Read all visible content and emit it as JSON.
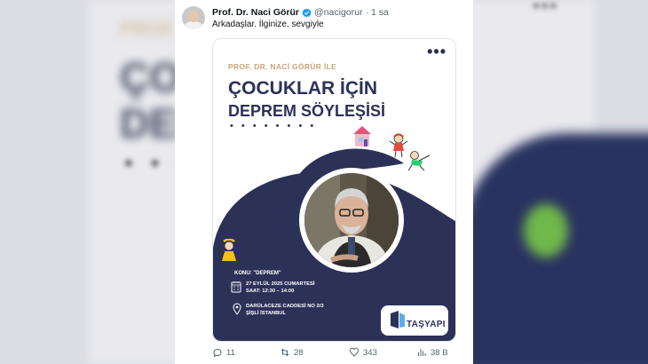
{
  "tweet": {
    "author_name": "Prof. Dr. Naci Görür",
    "author_handle": "@nacigorur",
    "separator": "·",
    "time": "1 sa",
    "text": "Arkadaşlar. İlginize, sevgiyle"
  },
  "poster": {
    "subtitle": "PROF. DR. NACİ GÖRÜR İLE",
    "title_line1": "ÇOCUKLAR İÇİN",
    "title_line2": "DEPREM SÖYLEŞİSİ",
    "dots": "• • • • • • • •",
    "konu": "KONU: \"DEPREM\"",
    "date": "27 EYLÜL 2025 CUMARTESİ",
    "saat": "SAAT: 12:30 – 14:00",
    "address_line1": "DARÜLACEZE CADDESİ NO 2/3",
    "address_line2": "ŞİŞLİ İSTANBUL",
    "brand": "TAŞYAPI",
    "menu_label": "•••"
  },
  "actions": {
    "replies": "11",
    "reposts": "28",
    "likes": "343",
    "views": "38 B"
  },
  "background": {
    "blur_small": "PROF. DR.",
    "blur_line1": "ÇOC",
    "blur_line2": "DEP",
    "blur_more": "•••"
  },
  "icons": {
    "verified": "verified-badge-icon",
    "reply": "reply-icon",
    "repost": "repost-icon",
    "like": "heart-icon",
    "views": "views-chart-icon"
  },
  "colors": {
    "navy": "#2c3158",
    "accent_gold": "#c9a57a",
    "verified_blue": "#1d9bf0"
  }
}
